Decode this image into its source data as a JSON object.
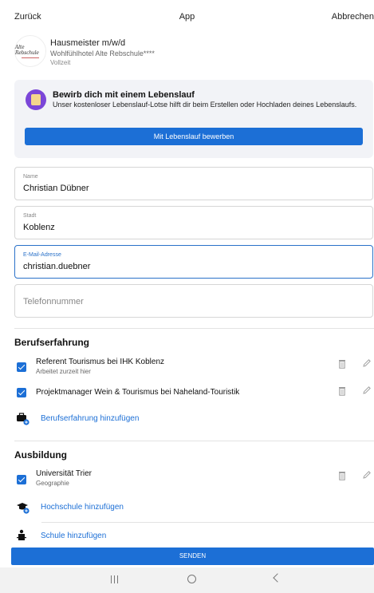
{
  "topbar": {
    "back": "Zurück",
    "title": "App",
    "cancel": "Abbrechen"
  },
  "job": {
    "logo_text": "Alte Rebschule",
    "title": "Hausmeister m/w/d",
    "company": "Wohlfühlhotel Alte Rebschule****",
    "type": "Vollzeit"
  },
  "cv_promo": {
    "title": "Bewirb dich mit einem Lebenslauf",
    "description": "Unser kostenloser Lebenslauf-Lotse hilft dir beim Erstellen oder Hochladen deines Lebenslaufs.",
    "button": "Mit Lebenslauf bewerben"
  },
  "form": {
    "name": {
      "label": "Name",
      "value": "Christian Dübner"
    },
    "city": {
      "label": "Stadt",
      "value": "Koblenz"
    },
    "email": {
      "label": "E-Mail-Adresse",
      "value": "christian.duebner"
    },
    "phone": {
      "placeholder": "Telefonnummer"
    }
  },
  "experience": {
    "title": "Berufserfahrung",
    "items": [
      {
        "title": "Referent Tourismus bei IHK Koblenz",
        "sub": "Arbeitet zurzeit hier"
      },
      {
        "title": "Projektmanager Wein & Tourismus bei Naheland-Touristik",
        "sub": ""
      }
    ],
    "add_label": "Berufserfahrung hinzufügen"
  },
  "education": {
    "title": "Ausbildung",
    "items": [
      {
        "title": "Universität Trier",
        "sub": "Geographie"
      }
    ],
    "add_university": "Hochschule hinzufügen",
    "add_school": "Schule hinzufügen"
  },
  "send_button": "SENDEN",
  "colors": {
    "accent": "#1c6fd6",
    "cv_icon": "#7b46d8"
  },
  "icons": [
    "trash-icon",
    "pencil-icon",
    "briefcase-add-icon",
    "graduation-cap-add-icon",
    "school-add-icon"
  ]
}
